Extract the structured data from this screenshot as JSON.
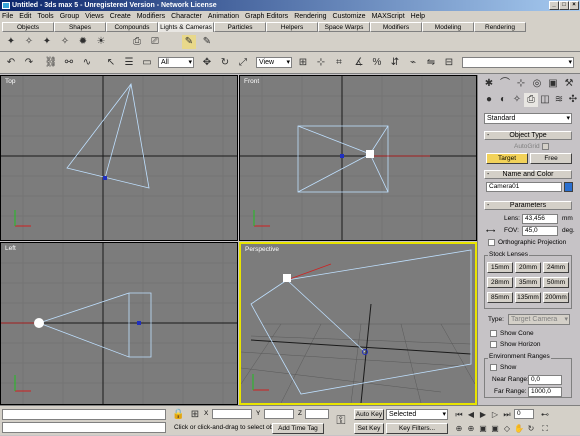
{
  "window": {
    "title": "Untitled - 3ds max 5 - Unregistered Version - Network License"
  },
  "menu": [
    "File",
    "Edit",
    "Tools",
    "Group",
    "Views",
    "Create",
    "Modifiers",
    "Character",
    "Animation",
    "Graph Editors",
    "Rendering",
    "Customize",
    "MAXScript",
    "Help"
  ],
  "tabs": [
    "Objects",
    "Shapes",
    "Compounds",
    "Lights & Cameras",
    "Particles",
    "Helpers",
    "Space Warps",
    "Modifiers",
    "Modeling",
    "Rendering"
  ],
  "active_tab": "Lights & Cameras",
  "toolbar": {
    "selection_filter": "All",
    "reference_coord": "View",
    "selection_set": ""
  },
  "viewports": {
    "top": "Top",
    "front": "Front",
    "left": "Left",
    "perspective": "Perspective"
  },
  "command_panel": {
    "category": "Standard",
    "object_type": {
      "header": "Object Type",
      "autogrid": "AutoGrid",
      "target": "Target",
      "free": "Free"
    },
    "name_color": {
      "header": "Name and Color",
      "name": "Camera01",
      "color": "#2a6fd0"
    },
    "parameters": {
      "header": "Parameters",
      "lens_label": "Lens:",
      "lens_value": "43,456",
      "lens_unit": "mm",
      "fov_label": "FOV:",
      "fov_value": "45,0",
      "fov_unit": "deg.",
      "ortho": "Orthographic Projection",
      "stock_lenses_label": "Stock Lenses",
      "stock_lenses": [
        "15mm",
        "20mm",
        "24mm",
        "28mm",
        "35mm",
        "50mm",
        "85mm",
        "135mm",
        "200mm"
      ],
      "type_label": "Type:",
      "type_value": "Target Camera",
      "show_cone": "Show Cone",
      "show_horizon": "Show Horizon",
      "env_label": "Environment Ranges",
      "show": "Show",
      "near_label": "Near Range:",
      "near_value": "0,0",
      "far_label": "Far Range:",
      "far_value": "1000,0"
    }
  },
  "status": {
    "prompt": "Click or click-and-drag to select ob",
    "add_time_tag": "Add Time Tag",
    "x_label": "X",
    "y_label": "Y",
    "z_label": "Z",
    "auto_key": "Auto Key",
    "selected": "Selected",
    "set_key": "Set Key",
    "key_filters": "Key Filters...",
    "frame": "0"
  }
}
